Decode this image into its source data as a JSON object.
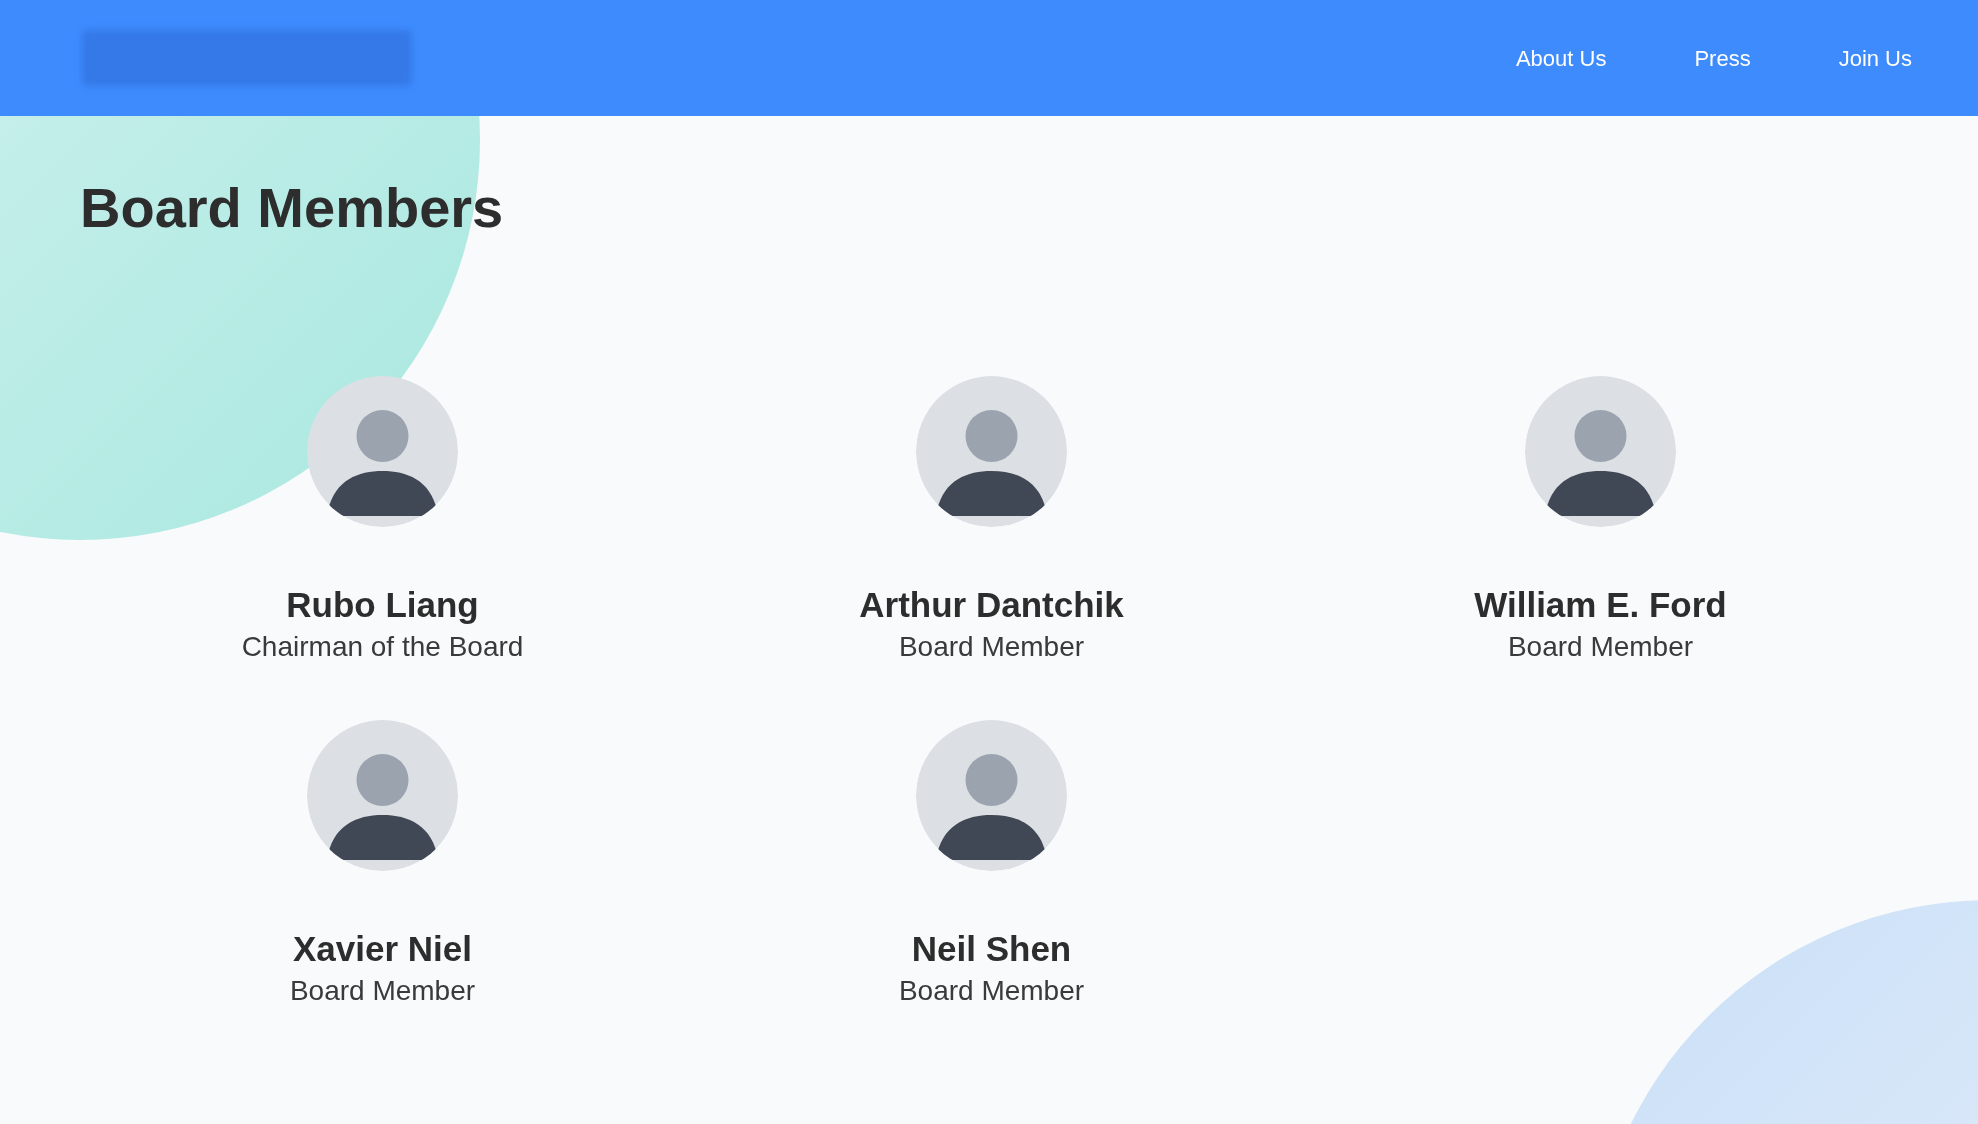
{
  "nav": {
    "links": [
      {
        "label": "About Us"
      },
      {
        "label": "Press"
      },
      {
        "label": "Join Us"
      }
    ]
  },
  "heading": "Board Members",
  "members": [
    {
      "name": "Rubo Liang",
      "role": "Chairman of the Board"
    },
    {
      "name": "Arthur Dantchik",
      "role": "Board Member"
    },
    {
      "name": "William E. Ford",
      "role": "Board Member"
    },
    {
      "name": "Xavier Niel",
      "role": "Board Member"
    },
    {
      "name": "Neil Shen",
      "role": "Board Member"
    }
  ]
}
